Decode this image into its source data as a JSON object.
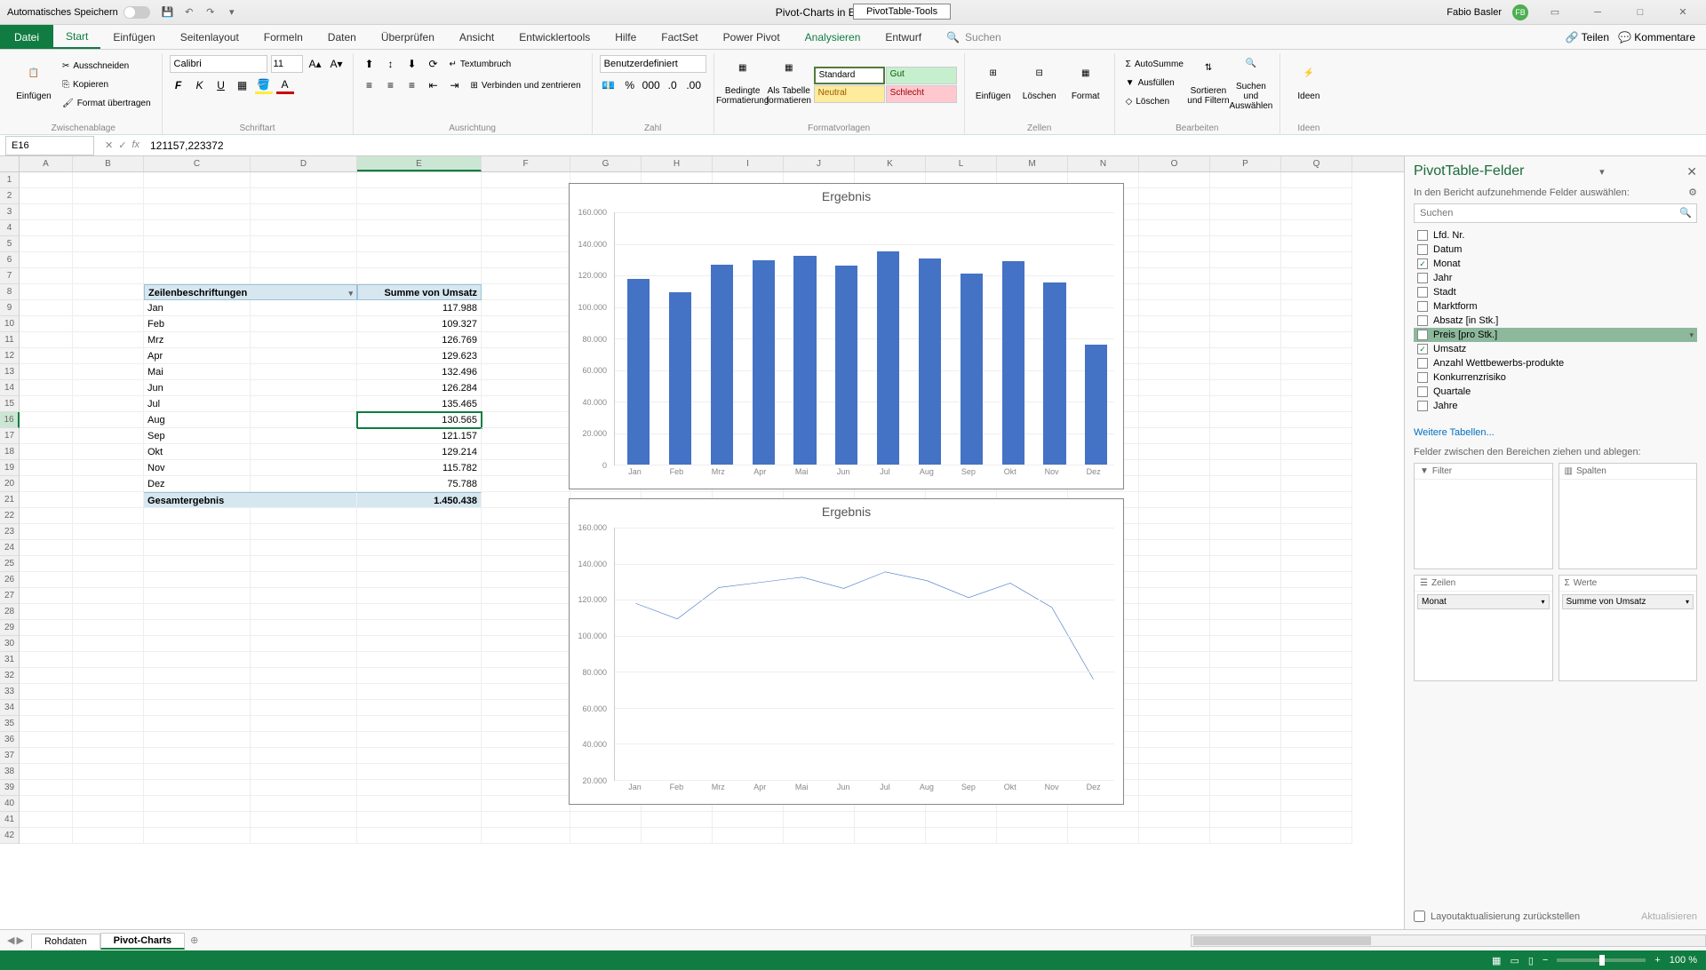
{
  "titlebar": {
    "auto_save": "Automatisches Speichern",
    "doc_title": "Pivot-Charts in Excel  -  Excel",
    "tool_context": "PivotTable-Tools",
    "user_name": "Fabio Basler",
    "user_initials": "FB"
  },
  "tabs": {
    "file": "Datei",
    "start": "Start",
    "einfuegen": "Einfügen",
    "seitenlayout": "Seitenlayout",
    "formeln": "Formeln",
    "daten": "Daten",
    "ueberpruefen": "Überprüfen",
    "ansicht": "Ansicht",
    "entwickler": "Entwicklertools",
    "hilfe": "Hilfe",
    "factset": "FactSet",
    "powerpivot": "Power Pivot",
    "analysieren": "Analysieren",
    "entwurf": "Entwurf",
    "suchen": "Suchen",
    "teilen": "Teilen",
    "kommentare": "Kommentare"
  },
  "ribbon": {
    "einfuegen": "Einfügen",
    "ausschneiden": "Ausschneiden",
    "kopieren": "Kopieren",
    "format_uebertragen": "Format übertragen",
    "zwischenablage": "Zwischenablage",
    "font_name": "Calibri",
    "font_size": "11",
    "schriftart": "Schriftart",
    "textumbruch": "Textumbruch",
    "verbinden": "Verbinden und zentrieren",
    "ausrichtung": "Ausrichtung",
    "numfmt": "Benutzerdefiniert",
    "zahl": "Zahl",
    "bedingte": "Bedingte Formatierung",
    "als_tabelle": "Als Tabelle formatieren",
    "standard": "Standard",
    "gut": "Gut",
    "neutral": "Neutral",
    "schlecht": "Schlecht",
    "formatvorlagen": "Formatvorlagen",
    "einfuegen2": "Einfügen",
    "loeschen": "Löschen",
    "format": "Format",
    "zellen": "Zellen",
    "autosum": "AutoSumme",
    "ausfuellen": "Ausfüllen",
    "loeschen2": "Löschen",
    "sort": "Sortieren und Filtern",
    "suchen": "Suchen und Auswählen",
    "bearbeiten": "Bearbeiten",
    "ideen": "Ideen",
    "ideen_grp": "Ideen"
  },
  "fbar": {
    "cell_ref": "E16",
    "formula": "121157,223372"
  },
  "pivot_table": {
    "hdr_row": "Zeilenbeschriftungen",
    "hdr_val": "Summe von Umsatz",
    "rows": [
      {
        "m": "Jan",
        "v": "117.988"
      },
      {
        "m": "Feb",
        "v": "109.327"
      },
      {
        "m": "Mrz",
        "v": "126.769"
      },
      {
        "m": "Apr",
        "v": "129.623"
      },
      {
        "m": "Mai",
        "v": "132.496"
      },
      {
        "m": "Jun",
        "v": "126.284"
      },
      {
        "m": "Jul",
        "v": "135.465"
      },
      {
        "m": "Aug",
        "v": "130.565"
      },
      {
        "m": "Sep",
        "v": "121.157"
      },
      {
        "m": "Okt",
        "v": "129.214"
      },
      {
        "m": "Nov",
        "v": "115.782"
      },
      {
        "m": "Dez",
        "v": "75.788"
      }
    ],
    "total_lbl": "Gesamtergebnis",
    "total_val": "1.450.438"
  },
  "chart_data": [
    {
      "type": "bar",
      "title": "Ergebnis",
      "categories": [
        "Jan",
        "Feb",
        "Mrz",
        "Apr",
        "Mai",
        "Jun",
        "Jul",
        "Aug",
        "Sep",
        "Okt",
        "Nov",
        "Dez"
      ],
      "values": [
        117988,
        109327,
        126769,
        129623,
        132496,
        126284,
        135465,
        130565,
        121157,
        129214,
        115782,
        75788
      ],
      "ylim": [
        0,
        160000
      ],
      "yticks": [
        "160.000",
        "140.000",
        "120.000",
        "100.000",
        "80.000",
        "60.000",
        "40.000",
        "20.000",
        "0"
      ]
    },
    {
      "type": "line",
      "title": "Ergebnis",
      "categories": [
        "Jan",
        "Feb",
        "Mrz",
        "Apr",
        "Mai",
        "Jun",
        "Jul",
        "Aug",
        "Sep",
        "Okt",
        "Nov",
        "Dez"
      ],
      "values": [
        117988,
        109327,
        126769,
        129623,
        132496,
        126284,
        135465,
        130565,
        121157,
        129214,
        115782,
        75788
      ],
      "ylim": [
        20000,
        160000
      ],
      "yticks": [
        "160.000",
        "140.000",
        "120.000",
        "100.000",
        "80.000",
        "60.000",
        "40.000",
        "20.000"
      ]
    }
  ],
  "taskpane": {
    "title": "PivotTable-Felder",
    "sub": "In den Bericht aufzunehmende Felder auswählen:",
    "search_ph": "Suchen",
    "fields": [
      {
        "name": "Lfd. Nr.",
        "checked": false
      },
      {
        "name": "Datum",
        "checked": false
      },
      {
        "name": "Monat",
        "checked": true
      },
      {
        "name": "Jahr",
        "checked": false
      },
      {
        "name": "Stadt",
        "checked": false
      },
      {
        "name": "Marktform",
        "checked": false
      },
      {
        "name": "Absatz [in Stk.]",
        "checked": false
      },
      {
        "name": "Preis [pro Stk.]",
        "checked": false,
        "hover": true
      },
      {
        "name": "Umsatz",
        "checked": true
      },
      {
        "name": "Anzahl Wettbewerbs-produkte",
        "checked": false
      },
      {
        "name": "Konkurrenzrisiko",
        "checked": false
      },
      {
        "name": "Quartale",
        "checked": false
      },
      {
        "name": "Jahre",
        "checked": false
      }
    ],
    "weitere": "Weitere Tabellen...",
    "areas_label": "Felder zwischen den Bereichen ziehen und ablegen:",
    "filter": "Filter",
    "spalten": "Spalten",
    "zeilen": "Zeilen",
    "werte": "Werte",
    "zeilen_pill": "Monat",
    "werte_pill": "Summe von Umsatz",
    "defer": "Layoutaktualisierung zurückstellen",
    "update": "Aktualisieren"
  },
  "sheets": {
    "rohdaten": "Rohdaten",
    "pivot": "Pivot-Charts"
  },
  "statusbar": {
    "zoom": "100 %"
  },
  "col_widths": {
    "A": 60,
    "B": 80,
    "C": 120,
    "D": 120,
    "E": 140,
    "F": 100,
    "G": 80,
    "H": 80,
    "I": 80,
    "J": 80,
    "K": 80,
    "L": 80,
    "M": 80,
    "N": 80,
    "O": 80,
    "P": 80,
    "Q": 80
  }
}
